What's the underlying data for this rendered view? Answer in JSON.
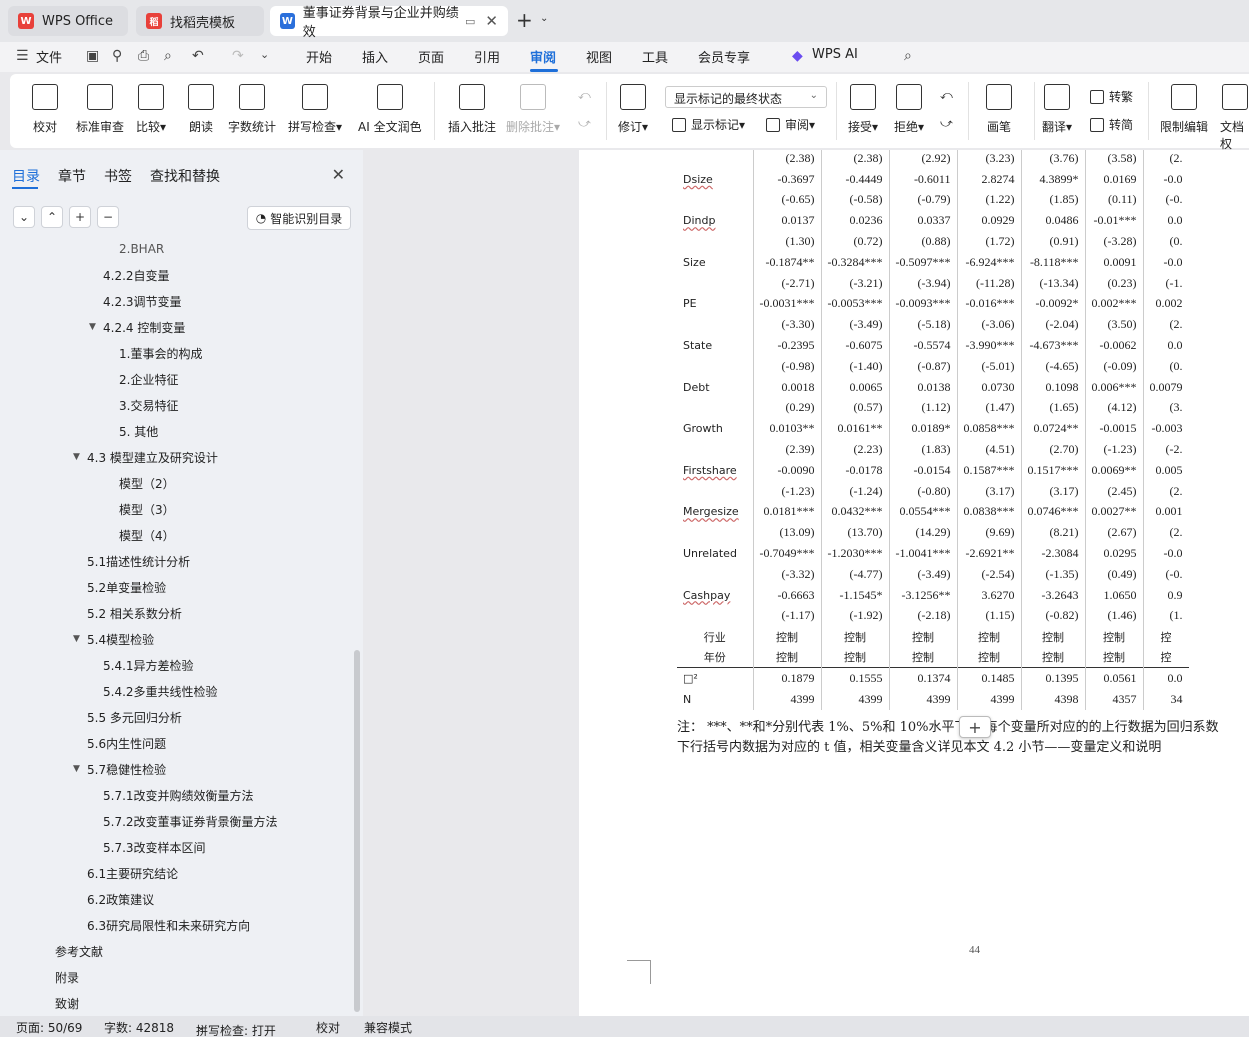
{
  "tabs": [
    {
      "label": "WPS Office",
      "logo": "W"
    },
    {
      "label": "找稻壳模板",
      "logo": "稻"
    },
    {
      "label": "董事证券背景与企业并购绩效",
      "logo": "W"
    }
  ],
  "menu": {
    "file": "文件",
    "items": [
      "开始",
      "插入",
      "页面",
      "引用",
      "审阅",
      "视图",
      "工具",
      "会员专享",
      "WPS AI"
    ],
    "active": "审阅"
  },
  "ribbon": {
    "proofread": "校对",
    "standard_review": "标准审查",
    "compare": "比较",
    "read_aloud": "朗读",
    "word_count": "字数统计",
    "spell_check": "拼写检查",
    "ai_polish": "AI 全文润色",
    "insert_comment": "插入批注",
    "delete_comment": "删除批注",
    "track_changes": "修订",
    "markup_dropdown": "显示标记的最终状态",
    "show_markup": "显示标记",
    "review_pane": "审阅",
    "accept": "接受",
    "reject": "拒绝",
    "pen": "画笔",
    "translate": "翻译",
    "to_traditional": "转繁",
    "to_simplified": "转简",
    "restrict_edit": "限制编辑",
    "doc_rights": "文档权"
  },
  "left_panel": {
    "tabs": [
      "目录",
      "章节",
      "书签",
      "查找和替换"
    ],
    "smart_toc": "智能识别目录",
    "toc": [
      "2.BHAR",
      "4.2.2自变量",
      "4.2.3调节变量",
      "4.2.4 控制变量",
      "1.董事会的构成",
      "2.企业特征",
      "3.交易特征",
      "5. 其他",
      "4.3 模型建立及研究设计",
      "模型（2）",
      "模型（3）",
      "模型（4）",
      "5.1描述性统计分析",
      "5.2单变量检验",
      "5.2 相关系数分析",
      "5.4模型检验",
      "5.4.1异方差检验",
      "5.4.2多重共线性检验",
      "5.5 多元回归分析",
      "5.6内生性问题",
      "5.7稳健性检验",
      "5.7.1改变并购绩效衡量方法",
      "5.7.2改变董事证券背景衡量方法",
      "5.7.3改变样本区间",
      "6.1主要研究结论",
      "6.2政策建议",
      "6.3研究局限性和未来研究方向",
      "参考文献",
      "附录",
      "致谢"
    ]
  },
  "table": {
    "rows": [
      {
        "label": "",
        "vals": [
          "(2.38)",
          "(2.38)",
          "(2.92)",
          "(3.23)",
          "(3.76)",
          "(3.58)",
          "(2."
        ]
      },
      {
        "label": "Dsize",
        "vals": [
          "-0.3697",
          "-0.4449",
          "-0.6011",
          "2.8274",
          "4.3899*",
          "0.0169",
          "-0.0"
        ]
      },
      {
        "label": "",
        "vals": [
          "(-0.65)",
          "(-0.58)",
          "(-0.79)",
          "(1.22)",
          "(1.85)",
          "(0.11)",
          "(-0."
        ]
      },
      {
        "label": "Dindp",
        "vals": [
          "0.0137",
          "0.0236",
          "0.0337",
          "0.0929",
          "0.0486",
          "-0.01***",
          "0.0"
        ]
      },
      {
        "label": "",
        "vals": [
          "(1.30)",
          "(0.72)",
          "(0.88)",
          "(1.72)",
          "(0.91)",
          "(-3.28)",
          "(0."
        ]
      },
      {
        "label": "Size",
        "vals": [
          "-0.1874**",
          "-0.3284***",
          "-0.5097***",
          "-6.924***",
          "-8.118***",
          "0.0091",
          "-0.0"
        ]
      },
      {
        "label": "",
        "vals": [
          "(-2.71)",
          "(-3.21)",
          "(-3.94)",
          "(-11.28)",
          "(-13.34)",
          "(0.23)",
          "(-1."
        ]
      },
      {
        "label": "PE",
        "vals": [
          "-0.0031***",
          "-0.0053***",
          "-0.0093***",
          "-0.016***",
          "-0.0092*",
          "0.002***",
          "0.002"
        ]
      },
      {
        "label": "",
        "vals": [
          "(-3.30)",
          "(-3.49)",
          "(-5.18)",
          "(-3.06)",
          "(-2.04)",
          "(3.50)",
          "(2."
        ]
      },
      {
        "label": "State",
        "vals": [
          "-0.2395",
          "-0.6075",
          "-0.5574",
          "-3.990***",
          "-4.673***",
          "-0.0062",
          "0.0"
        ]
      },
      {
        "label": "",
        "vals": [
          "(-0.98)",
          "(-1.40)",
          "(-0.87)",
          "(-5.01)",
          "(-4.65)",
          "(-0.09)",
          "(0."
        ]
      },
      {
        "label": "Debt",
        "vals": [
          "0.0018",
          "0.0065",
          "0.0138",
          "0.0730",
          "0.1098",
          "0.006***",
          "0.0079"
        ]
      },
      {
        "label": "",
        "vals": [
          "(0.29)",
          "(0.57)",
          "(1.12)",
          "(1.47)",
          "(1.65)",
          "(4.12)",
          "(3."
        ]
      },
      {
        "label": "Growth",
        "vals": [
          "0.0103**",
          "0.0161**",
          "0.0189*",
          "0.0858***",
          "0.0724**",
          "-0.0015",
          "-0.003"
        ]
      },
      {
        "label": "",
        "vals": [
          "(2.39)",
          "(2.23)",
          "(1.83)",
          "(4.51)",
          "(2.70)",
          "(-1.23)",
          "(-2."
        ]
      },
      {
        "label": "Firstshare",
        "vals": [
          "-0.0090",
          "-0.0178",
          "-0.0154",
          "0.1587***",
          "0.1517***",
          "0.0069**",
          "0.005"
        ]
      },
      {
        "label": "",
        "vals": [
          "(-1.23)",
          "(-1.24)",
          "(-0.80)",
          "(3.17)",
          "(3.17)",
          "(2.45)",
          "(2."
        ]
      },
      {
        "label": "Mergesize",
        "vals": [
          "0.0181***",
          "0.0432***",
          "0.0554***",
          "0.0838***",
          "0.0746***",
          "0.0027**",
          "0.001"
        ]
      },
      {
        "label": "",
        "vals": [
          "(13.09)",
          "(13.70)",
          "(14.29)",
          "(9.69)",
          "(8.21)",
          "(2.67)",
          "(2."
        ]
      },
      {
        "label": "Unrelated",
        "vals": [
          "-0.7049***",
          "-1.2030***",
          "-1.0041***",
          "-2.6921**",
          "-2.3084",
          "0.0295",
          "-0.0"
        ]
      },
      {
        "label": "",
        "vals": [
          "(-3.32)",
          "(-4.77)",
          "(-3.49)",
          "(-2.54)",
          "(-1.35)",
          "(0.49)",
          "(-0."
        ]
      },
      {
        "label": "Cashpay",
        "vals": [
          "-0.6663",
          "-1.1545*",
          "-3.1256**",
          "3.6270",
          "-3.2643",
          "1.0650",
          "0.9"
        ]
      },
      {
        "label": "",
        "vals": [
          "(-1.17)",
          "(-1.92)",
          "(-2.18)",
          "(1.15)",
          "(-0.82)",
          "(1.46)",
          "(1."
        ]
      }
    ],
    "controls": [
      {
        "label": "行业",
        "vals": [
          "控制",
          "控制",
          "控制",
          "控制",
          "控制",
          "控制",
          "控"
        ]
      },
      {
        "label": "年份",
        "vals": [
          "控制",
          "控制",
          "控制",
          "控制",
          "控制",
          "控制",
          "控"
        ]
      }
    ],
    "stats": [
      {
        "label": "□²",
        "vals": [
          "0.1879",
          "0.1555",
          "0.1374",
          "0.1485",
          "0.1395",
          "0.0561",
          "0.0"
        ]
      },
      {
        "label": "N",
        "vals": [
          "4399",
          "4399",
          "4399",
          "4399",
          "4398",
          "4357",
          "34"
        ]
      }
    ]
  },
  "note": {
    "line1": "注：  ***、**和*分别代表 1%、5%和 10%水平下        ，每个变量所对应的的上行数据为回归系数",
    "line2": "下行括号内数据为对应的 t 值，相关变量含义详见本文 4.2 小节——变量定义和说明"
  },
  "page_number": "44",
  "status": {
    "page": "页面: 50/69",
    "words": "字数: 42818",
    "spell": "拼写检查: 打开",
    "proof": "校对",
    "compat": "兼容模式"
  }
}
